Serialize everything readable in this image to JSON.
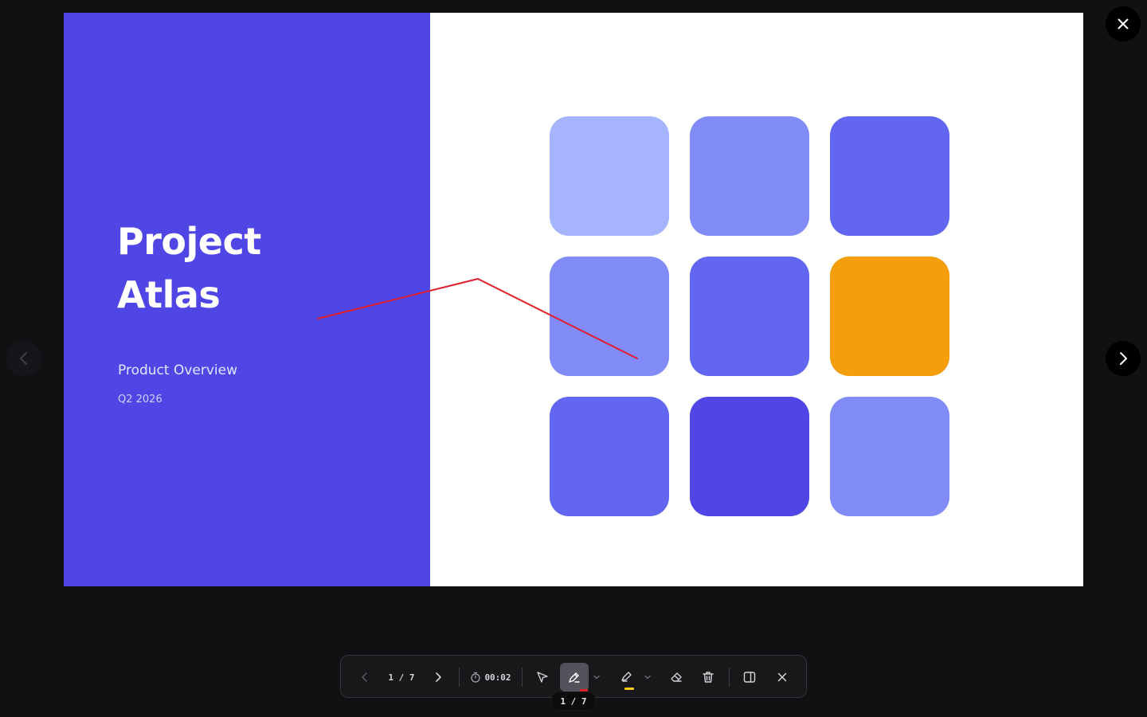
{
  "slide": {
    "title_line1": "Project",
    "title_line2": "Atlas",
    "subtitle": "Product Overview",
    "date": "Q2 2026",
    "accent_color": "#4f46e5",
    "tiles": [
      {
        "color": "#a5b4fc"
      },
      {
        "color": "#818cf8"
      },
      {
        "color": "#6366f1"
      },
      {
        "color": "#818cf8"
      },
      {
        "color": "#6366f1"
      },
      {
        "color": "#f59e0b"
      },
      {
        "color": "#6366f1"
      },
      {
        "color": "#4f46e5"
      },
      {
        "color": "#818cf8"
      }
    ]
  },
  "annotation": {
    "ink_color": "#e11d2a"
  },
  "toolbar": {
    "page_indicator": "1 / 7",
    "timer": "00:02",
    "pen_color": "#e11d2a",
    "highlighter_color": "#facc15",
    "icons": {
      "prev": "chevron-left-icon",
      "next": "chevron-right-icon",
      "timer": "stopwatch-icon",
      "pointer": "pointer-icon",
      "pen": "pen-icon",
      "highlighter": "highlighter-icon",
      "eraser": "eraser-icon",
      "clear": "trash-icon",
      "panel": "split-panel-icon",
      "exit": "close-icon"
    }
  },
  "tooltip": {
    "text": "1 / 7"
  }
}
